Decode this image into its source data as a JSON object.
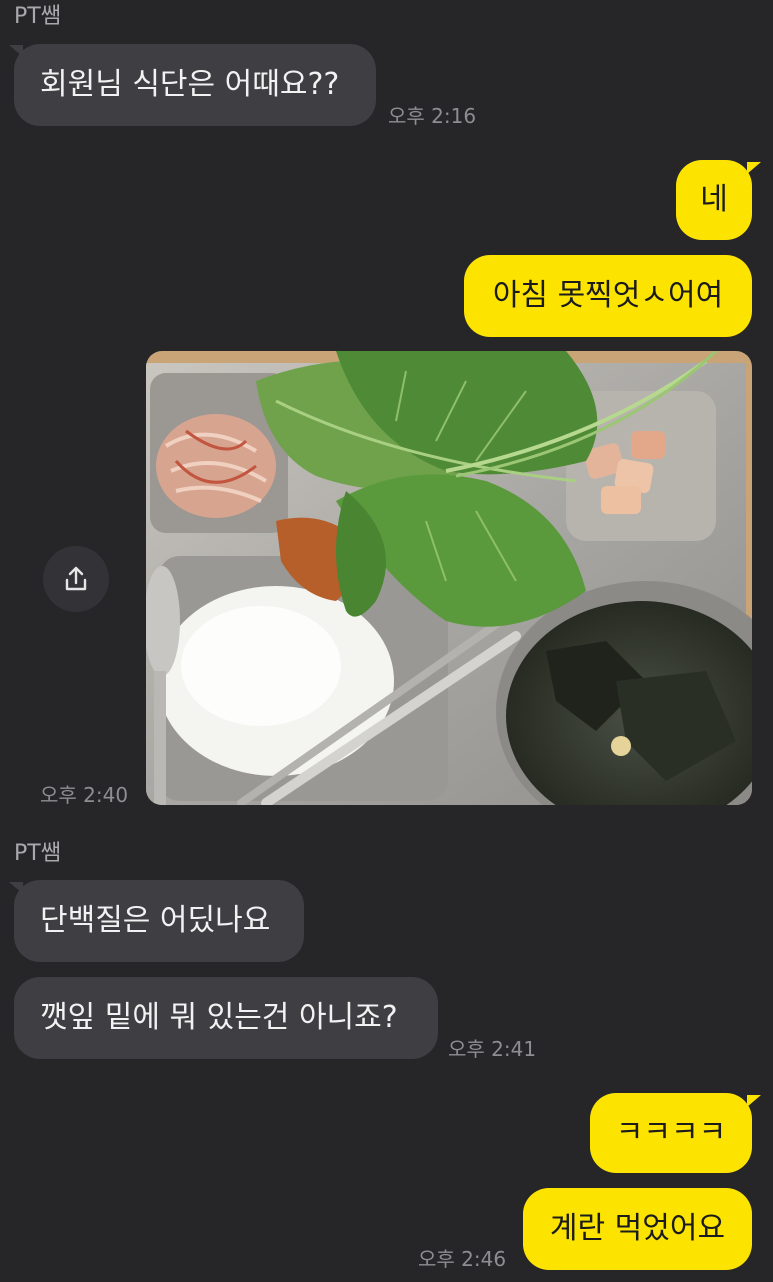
{
  "messages": {
    "m1": {
      "sender": "PT쌤",
      "text": "회원님 식단은 어때요??",
      "time": "오후 2:16"
    },
    "m2": {
      "text": "네"
    },
    "m3": {
      "text": "아침 못찍엇ㅅ어여"
    },
    "m4": {
      "time": "오후 2:40"
    },
    "m5": {
      "sender": "PT쌤",
      "text": "단백질은 어딨나요"
    },
    "m6": {
      "text": "깻잎 밑에 뭐 있는건 아니죠?",
      "time": "오후 2:41"
    },
    "m7": {
      "text": "ㅋㅋㅋㅋ"
    },
    "m8": {
      "text": "계란 먹었어요",
      "time": "오후 2:46"
    }
  },
  "icons": {
    "share": "share-icon"
  },
  "colors": {
    "background": "#262629",
    "incoming": "#3f3f43",
    "outgoing": "#fde400"
  }
}
